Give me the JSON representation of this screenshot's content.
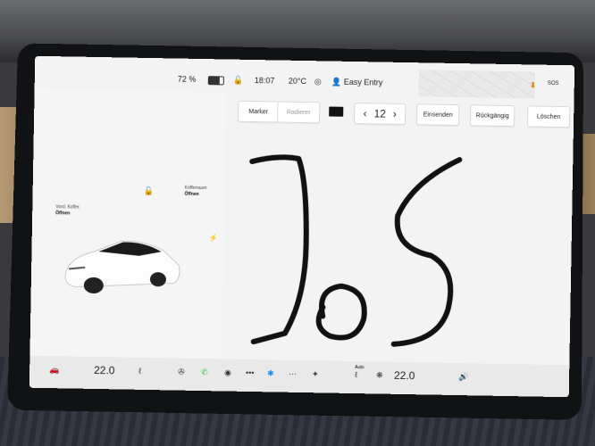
{
  "status": {
    "battery": "72 %",
    "battery_level": 0.72,
    "time": "18:07",
    "temperature": "20°C",
    "profile": "Easy Entry",
    "sos": "SOS"
  },
  "vehicle": {
    "frunk_label": "Vord. Koffer.",
    "frunk_action": "Öffnen",
    "trunk_label": "Kofferraum",
    "trunk_action": "Öffnen"
  },
  "toolbar": {
    "marker": "Marker",
    "eraser": "Radierer",
    "color": "#111111",
    "size": "12",
    "submit": "Einsenden",
    "undo": "Rückgängig",
    "delete": "Löschen"
  },
  "dock": {
    "driver_temp": "22.0",
    "passenger_temp": "22.0",
    "auto": "Auto"
  },
  "colors": {
    "screen_bg": "#f3f3f3",
    "ink": "#111111",
    "phone": "#2ecc40",
    "bluetooth": "#1e88e5"
  }
}
